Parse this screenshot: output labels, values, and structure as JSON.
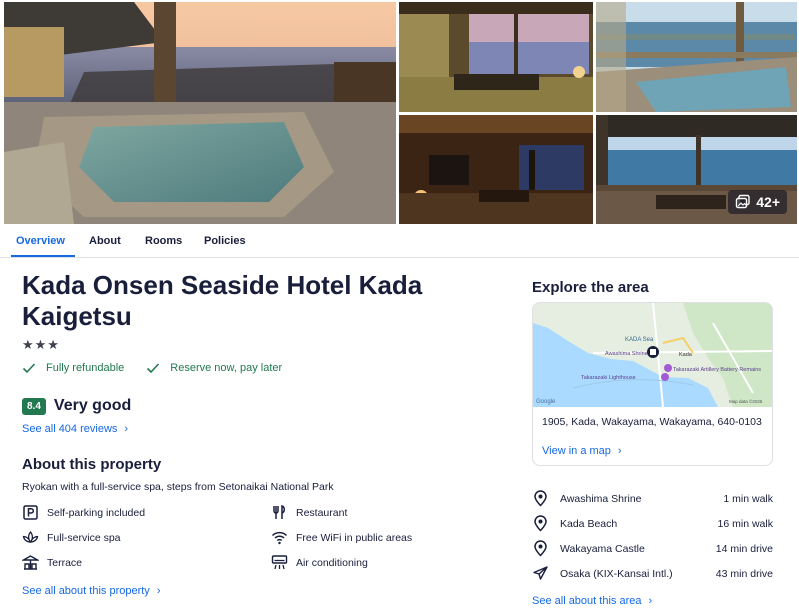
{
  "gallery": {
    "more_photos_label": "42+",
    "photos": [
      {
        "name": "Outdoor stone bath overlooking sea at sunset"
      },
      {
        "name": "Tatami room with sea view window"
      },
      {
        "name": "Terrace bath with sea view"
      },
      {
        "name": "Dim tatami guest room"
      },
      {
        "name": "Open-air terrace dining by the sea"
      }
    ]
  },
  "tabs": [
    {
      "label": "Overview",
      "active": true
    },
    {
      "label": "About",
      "active": false
    },
    {
      "label": "Rooms",
      "active": false
    },
    {
      "label": "Policies",
      "active": false
    }
  ],
  "property": {
    "title": "Kada Onsen Seaside Hotel Kada Kaigetsu",
    "stars": "★★★",
    "star_count": 3,
    "perks": [
      "Fully refundable",
      "Reserve now, pay later"
    ],
    "score": "8.4",
    "rating_word": "Very good",
    "reviews_link": "See all 404 reviews"
  },
  "about": {
    "title": "About this property",
    "description": "Ryokan with a full-service spa, steps from Setonaikai National Park",
    "amenities": [
      {
        "label": "Self-parking included",
        "icon": "parking-icon"
      },
      {
        "label": "Restaurant",
        "icon": "restaurant-icon"
      },
      {
        "label": "Full-service spa",
        "icon": "spa-icon"
      },
      {
        "label": "Free WiFi in public areas",
        "icon": "wifi-icon"
      },
      {
        "label": "Terrace",
        "icon": "terrace-icon"
      },
      {
        "label": "Air conditioning",
        "icon": "air-conditioning-icon"
      }
    ],
    "link": "See all about this property"
  },
  "explore": {
    "title": "Explore the area",
    "map": {
      "labels": [
        "KADA Sea",
        "Awashima Shrine",
        "Kada",
        "Takarazaki Lighthouse",
        "Takarazaki Artillery Battery Remains",
        "Google",
        "Map data ©2025"
      ]
    },
    "address": "1905, Kada, Wakayama, Wakayama, 640-0103",
    "map_link": "View in a map",
    "places": [
      {
        "name": "Awashima Shrine",
        "distance": "1 min walk",
        "icon": "location-pin-icon"
      },
      {
        "name": "Kada Beach",
        "distance": "16 min walk",
        "icon": "location-pin-icon"
      },
      {
        "name": "Wakayama Castle",
        "distance": "14 min drive",
        "icon": "location-pin-icon"
      },
      {
        "name": "Osaka (KIX-Kansai Intl.)",
        "distance": "43 min drive",
        "icon": "airplane-icon"
      }
    ],
    "area_link": "See all about this area"
  },
  "colors": {
    "accent": "#1668e3",
    "positive": "#227950",
    "text": "#191e3b",
    "divider": "#dfe0e4"
  }
}
